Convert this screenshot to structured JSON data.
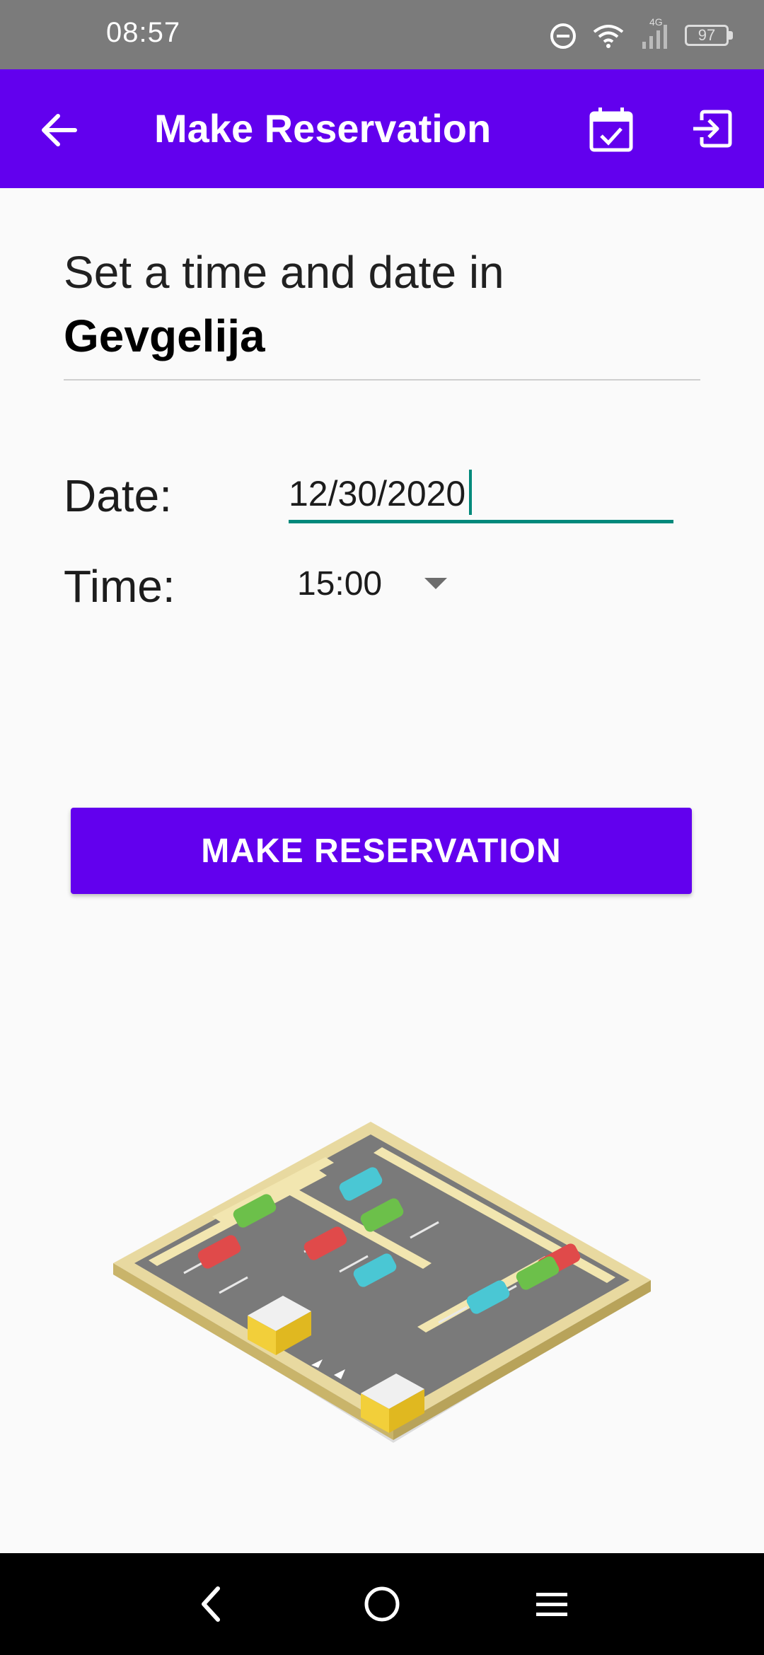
{
  "status_bar": {
    "time": "08:57",
    "network": "4G",
    "battery": "97",
    "icons": [
      "do-not-disturb-icon",
      "wifi-icon",
      "signal-icon",
      "battery-icon"
    ]
  },
  "app_bar": {
    "title": "Make Reservation",
    "back_icon": "arrow-back-icon",
    "calendar_icon": "calendar-check-icon",
    "exit_icon": "exit-to-app-icon"
  },
  "form": {
    "heading_line1": "Set a time and date in",
    "city": "Gevgelija",
    "date_label": "Date:",
    "date_value": "12/30/2020",
    "time_label": "Time:",
    "time_value": "15:00"
  },
  "button": {
    "label": "MAKE RESERVATION"
  },
  "nav_bar": {
    "icons": [
      "back-nav-icon",
      "home-nav-icon",
      "menu-nav-icon"
    ]
  },
  "colors": {
    "primary": "#6200ee",
    "accent": "#00897b",
    "status_bar": "#7b7b7b"
  }
}
